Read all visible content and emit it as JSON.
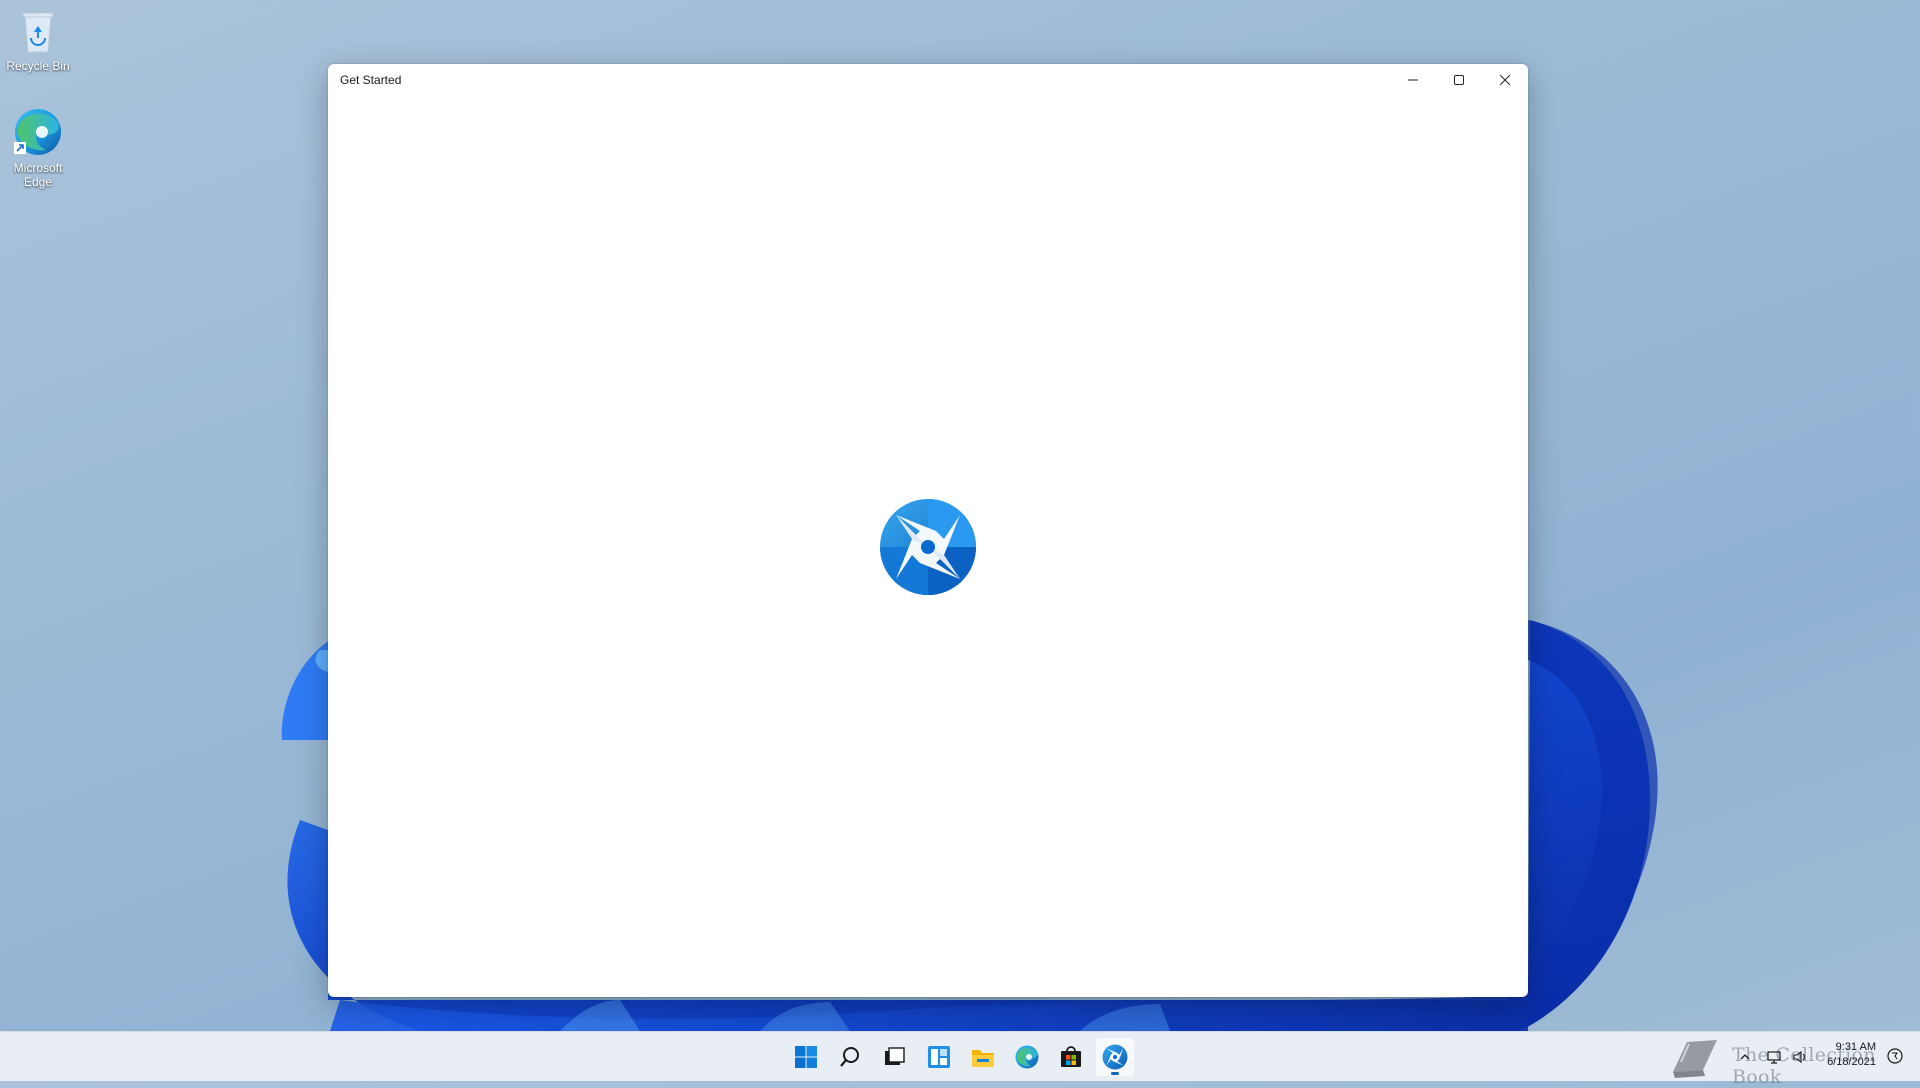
{
  "desktop": {
    "icons": [
      {
        "label": "Recycle Bin"
      },
      {
        "label": "Microsoft Edge"
      }
    ]
  },
  "window": {
    "title": "Get Started",
    "minimize_icon": "minimize-icon",
    "maximize_icon": "maximize-icon",
    "close_icon": "close-icon",
    "splash_icon": "get-started-logo-icon"
  },
  "taskbar": {
    "items": [
      {
        "icon": "start-windows-icon"
      },
      {
        "icon": "search-icon"
      },
      {
        "icon": "task-view-icon"
      },
      {
        "icon": "widgets-icon"
      },
      {
        "icon": "file-explorer-icon"
      },
      {
        "icon": "edge-icon"
      },
      {
        "icon": "store-icon"
      },
      {
        "icon": "get-started-icon",
        "active": true
      }
    ],
    "tray": {
      "icons": [
        "chevron-up-icon",
        "network-icon",
        "volume-icon"
      ],
      "time": "9:31 AM",
      "date": "6/18/2021",
      "notification_icon": "notification-icon"
    },
    "watermark": "The Collection Book"
  },
  "colors": {
    "accent": "#0a67c4",
    "bloom_dark": "#0a2fae",
    "bloom_light": "#2f7bf5",
    "window_bg": "#ffffff"
  }
}
